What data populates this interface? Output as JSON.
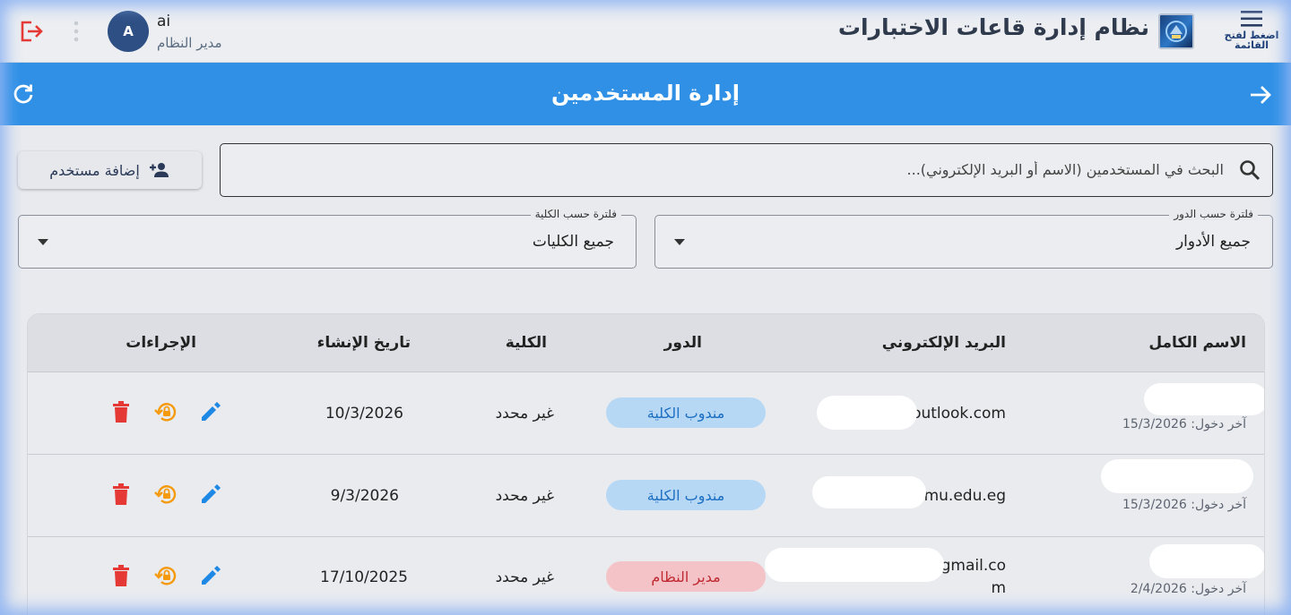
{
  "header": {
    "menu_label": "اضغط لفتح القائمة",
    "app_title": "نظام إدارة قاعات الاختبارات",
    "user": {
      "avatar_letter": "A",
      "name": "ai",
      "role": "مدير النظام"
    }
  },
  "page": {
    "title": "إدارة المستخدمين"
  },
  "search": {
    "placeholder": "البحث في المستخدمين (الاسم أو البريد الإلكتروني)..."
  },
  "add_user_label": "إضافة مستخدم",
  "filters": {
    "role": {
      "legend": "فلترة حسب الدور",
      "value": "جميع الأدوار"
    },
    "college": {
      "legend": "فلترة حسب الكلية",
      "value": "جميع الكليات"
    }
  },
  "table": {
    "columns": {
      "full_name": "الاسم الكامل",
      "email": "البريد الإلكتروني",
      "role": "الدور",
      "college": "الكلية",
      "created": "تاريخ الإنشاء",
      "actions": "الإجراءات"
    },
    "rows": [
      {
        "last_login": "آخر دخول: 15/3/2026",
        "email_line1": ")outlook.com",
        "email_line2": "",
        "role": "مندوب الكلية",
        "college": "غير محدد",
        "created": "10/3/2026"
      },
      {
        "last_login": "آخر دخول: 15/3/2026",
        "email_line1": "@mu.edu.eg",
        "email_line2": "",
        "role": "مندوب الكلية",
        "college": "غير محدد",
        "created": "9/3/2026"
      },
      {
        "last_login": "آخر دخول: 2/4/2026",
        "email_line1": ")gmail.co",
        "email_line2": "m",
        "role": "مدير النظام",
        "college": "غير محدد",
        "created": "17/10/2025"
      }
    ]
  },
  "colors": {
    "primary": "#2f90e6",
    "rep_badge": "#b7d8f5",
    "admin_badge": "#f4c3c8",
    "delete": "#e53935",
    "reset": "#f59a0c",
    "edit": "#1e88e5"
  },
  "icons": [
    "menu-icon",
    "logout-icon",
    "more-vert-icon",
    "arrow-forward-icon",
    "refresh-icon",
    "search-icon",
    "person-add-icon",
    "dropdown-caret-icon",
    "edit-icon",
    "lock-reset-icon",
    "delete-icon"
  ]
}
